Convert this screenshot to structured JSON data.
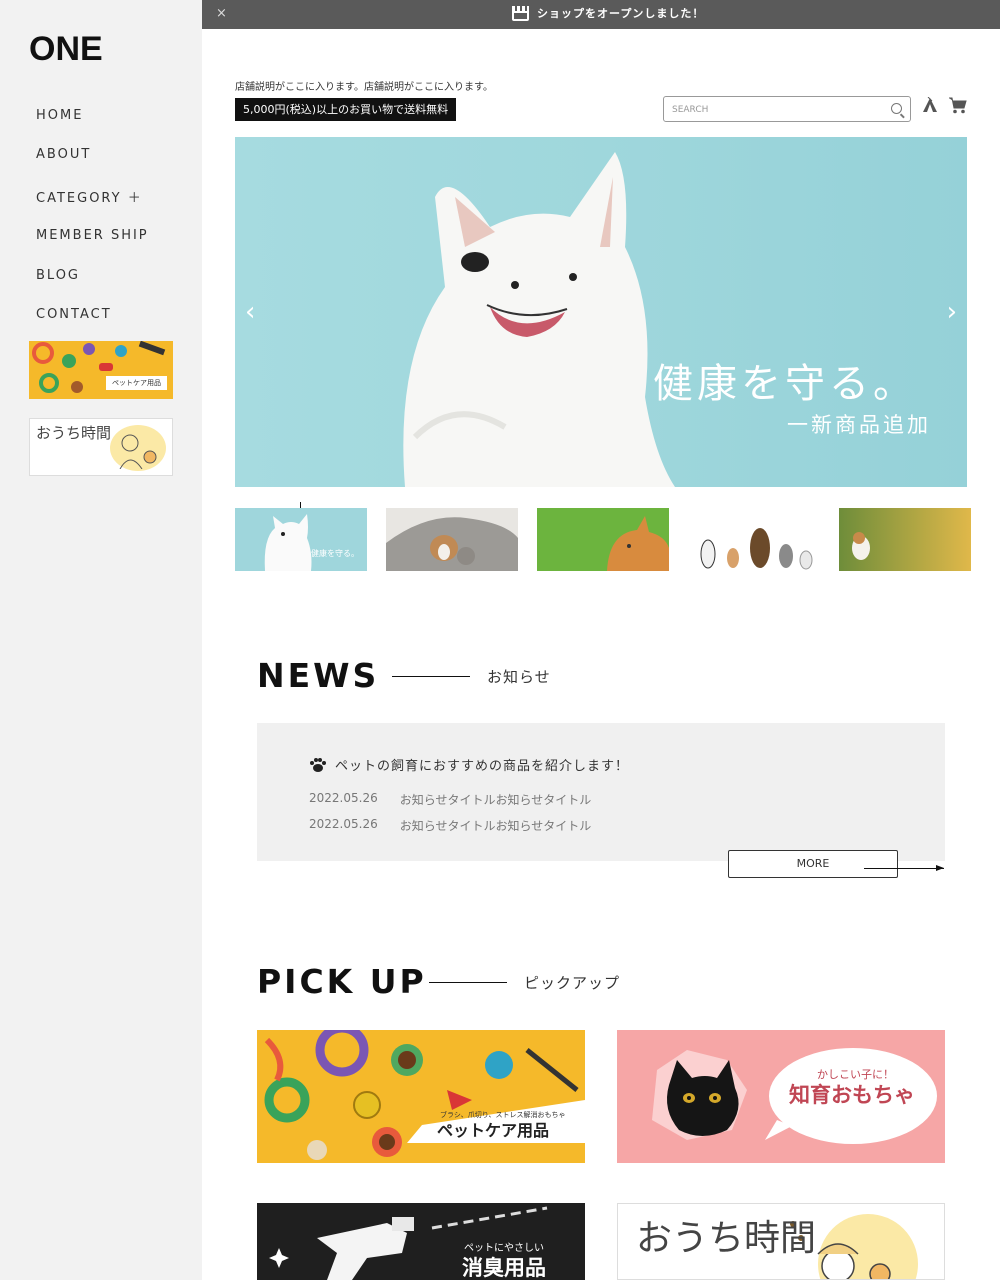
{
  "sidebar": {
    "logo": "ONE",
    "nav": [
      {
        "label": "HOME"
      },
      {
        "label": "ABOUT"
      },
      {
        "label": "CATEGORY ＋"
      },
      {
        "label": "MEMBER SHIP"
      },
      {
        "label": "BLOG"
      },
      {
        "label": "CONTACT"
      }
    ],
    "banner1": {
      "label": "ペットケア用品"
    },
    "banner2": {
      "title": "おうち時間"
    }
  },
  "announcement": {
    "close": "×",
    "message": "ショップをオープンしました！",
    "icon": "shop-icon"
  },
  "header": {
    "store_description": "店舗説明がここに入ります。店舗説明がここに入ります。",
    "shipping_badge": "5,000円(税込)以上のお買い物で送料無料",
    "search_placeholder": "SEARCH",
    "icons": [
      "search-icon",
      "tent-icon",
      "cart-icon"
    ]
  },
  "hero": {
    "title": "健康を守る。",
    "subtitle": "一新商品追加",
    "prev": "‹",
    "next": "›",
    "thumb_caption": "健康を守る。"
  },
  "news": {
    "title": "NEWS",
    "subtitle": "お知らせ",
    "headline": "ペットの飼育におすすめの商品を紹介します！",
    "items": [
      {
        "date": "2022.05.26",
        "title": "お知らせタイトルお知らせタイトル"
      },
      {
        "date": "2022.05.26",
        "title": "お知らせタイトルお知らせタイトル"
      }
    ],
    "more": "MORE"
  },
  "pickup": {
    "title": "PICK UP",
    "subtitle": "ピックアップ",
    "cards": [
      {
        "small": "ブラシ、爪切り、ストレス解消おもちゃ",
        "label": "ペットケア用品"
      },
      {
        "small": "かしこい子に！",
        "label": "知育おもちゃ"
      },
      {
        "small": "ペットにやさしい",
        "label": "消臭用品"
      },
      {
        "label": "おうち時間"
      }
    ]
  },
  "colors": {
    "topbar": "#5a5a5a",
    "sidebar": "#f2f2f2",
    "hero_bg": "#a6dbe0",
    "news_bg": "#f0f0f0"
  }
}
